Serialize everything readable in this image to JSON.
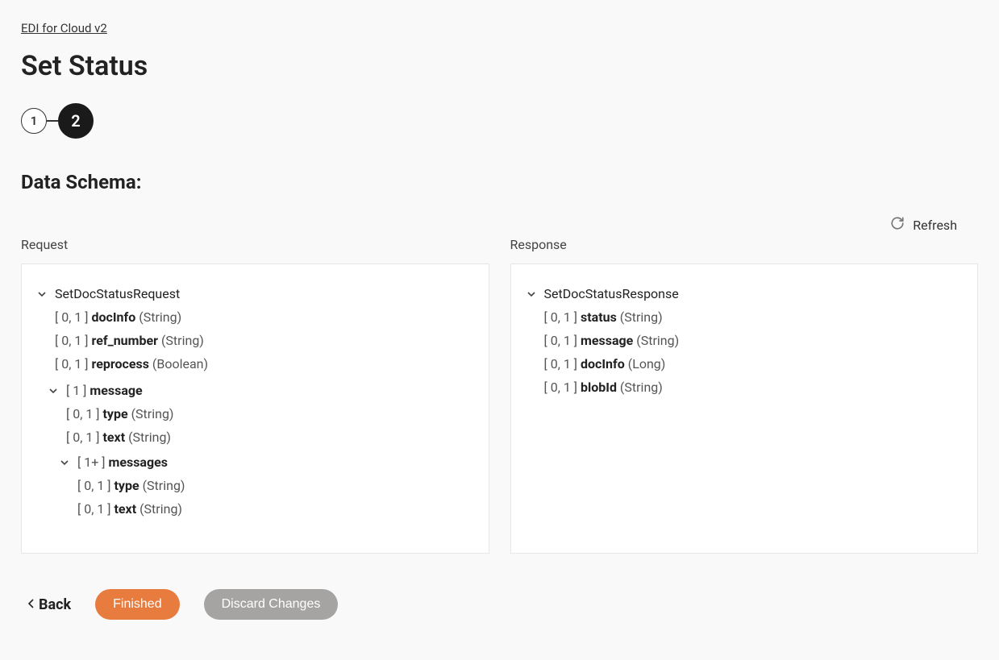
{
  "breadcrumb": "EDI for Cloud v2",
  "page_title": "Set Status",
  "stepper": {
    "step1": "1",
    "step2": "2"
  },
  "section_title": "Data Schema:",
  "refresh_label": "Refresh",
  "request": {
    "header": "Request",
    "root": "SetDocStatusRequest",
    "fields": [
      {
        "card": "[ 0, 1 ]",
        "name": "docInfo",
        "type": "(String)"
      },
      {
        "card": "[ 0, 1 ]",
        "name": "ref_number",
        "type": "(String)"
      },
      {
        "card": "[ 0, 1 ]",
        "name": "reprocess",
        "type": "(Boolean)"
      }
    ],
    "message": {
      "card": "[ 1 ]",
      "name": "message",
      "fields": [
        {
          "card": "[ 0, 1 ]",
          "name": "type",
          "type": "(String)"
        },
        {
          "card": "[ 0, 1 ]",
          "name": "text",
          "type": "(String)"
        }
      ],
      "messages": {
        "card": "[ 1+ ]",
        "name": "messages",
        "fields": [
          {
            "card": "[ 0, 1 ]",
            "name": "type",
            "type": "(String)"
          },
          {
            "card": "[ 0, 1 ]",
            "name": "text",
            "type": "(String)"
          }
        ]
      }
    }
  },
  "response": {
    "header": "Response",
    "root": "SetDocStatusResponse",
    "fields": [
      {
        "card": "[ 0, 1 ]",
        "name": "status",
        "type": "(String)"
      },
      {
        "card": "[ 0, 1 ]",
        "name": "message",
        "type": "(String)"
      },
      {
        "card": "[ 0, 1 ]",
        "name": "docInfo",
        "type": "(Long)"
      },
      {
        "card": "[ 0, 1 ]",
        "name": "blobId",
        "type": "(String)"
      }
    ]
  },
  "footer": {
    "back": "Back",
    "finished": "Finished",
    "discard": "Discard Changes"
  }
}
